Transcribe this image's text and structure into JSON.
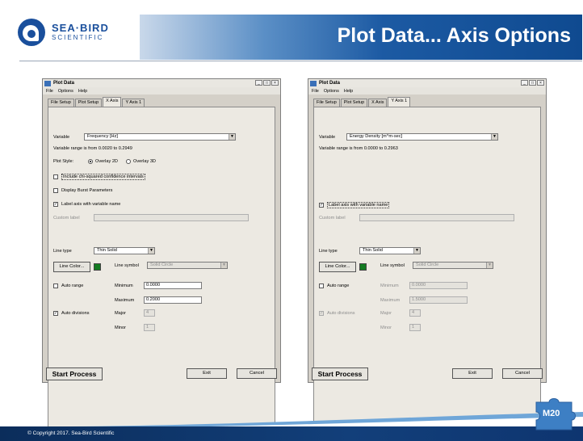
{
  "slide": {
    "title": "Plot Data... Axis Options",
    "logo": {
      "line1": "SEA·BIRD",
      "line2": "SCIENTIFIC"
    },
    "copyright": "© Copyright 2017. Sea-Bird Scientific",
    "badge": "M20"
  },
  "colors": {
    "brand_blue": "#1a4f9c",
    "window_bg": "#d4d0c8",
    "green_swatch": "#137b21"
  },
  "windows": [
    {
      "title": "Plot Data",
      "controls": [
        "_",
        "□",
        "×"
      ],
      "menu": [
        "File",
        "Options",
        "Help"
      ],
      "tabs": [
        "File Setup",
        "Plot Setup",
        "X Axis",
        "Y Axis 1"
      ],
      "active_tab": "X Axis",
      "variable_label": "Variable",
      "variable_value": "Frequency [Hz]",
      "range_text": "Variable range is from 0.0020 to 0.2949",
      "plot_style_label": "Plot Style:",
      "plot_style_options": [
        "Overlay 2D",
        "Overlay 3D"
      ],
      "chi_squared": "Include chi-squared confidence intervals",
      "burst": "Display Burst Parameters",
      "label_axis": "Label axis with variable name",
      "custom_label": "Custom label",
      "line_type_label": "Line type",
      "line_type_value": "Thin Solid",
      "line_color": "Line Color...",
      "line_symbol_label": "Line symbol",
      "line_symbol_value": "Solid Circle",
      "auto_range": "Auto range",
      "minimum_label": "Minimum",
      "minimum_value": "0.0000",
      "maximum_label": "Maximum",
      "maximum_value": "0.2000",
      "auto_divisions": "Auto divisions",
      "major_label": "Major",
      "major_value": "4",
      "minor_label": "Minor",
      "minor_value": "1",
      "start_process": "Start Process",
      "exit": "Exit",
      "cancel": "Cancel"
    },
    {
      "title": "Plot Data",
      "controls": [
        "_",
        "□",
        "×"
      ],
      "menu": [
        "File",
        "Options",
        "Help"
      ],
      "tabs": [
        "File Setup",
        "Plot Setup",
        "X Axis",
        "Y Axis 1"
      ],
      "active_tab": "Y Axis 1",
      "variable_label": "Variable",
      "variable_value": "Energy Density [m^m-sec]",
      "range_text": "Variable range is from 0.0000 to 0.2963",
      "label_axis": "Label axis with variable name",
      "custom_label": "Custom label",
      "line_type_label": "Line type",
      "line_type_value": "Thin Solid",
      "line_color": "Line Color...",
      "line_symbol_label": "Line symbol",
      "line_symbol_value": "Solid Circle",
      "auto_range": "Auto range",
      "minimum_label": "Minimum",
      "minimum_value": "0.0000",
      "maximum_label": "Maximum",
      "maximum_value": "1.5000",
      "auto_divisions": "Auto divisions",
      "major_label": "Major",
      "major_value": "4",
      "minor_label": "Minor",
      "minor_value": "1",
      "start_process": "Start Process",
      "exit": "Exit",
      "cancel": "Cancel"
    }
  ]
}
